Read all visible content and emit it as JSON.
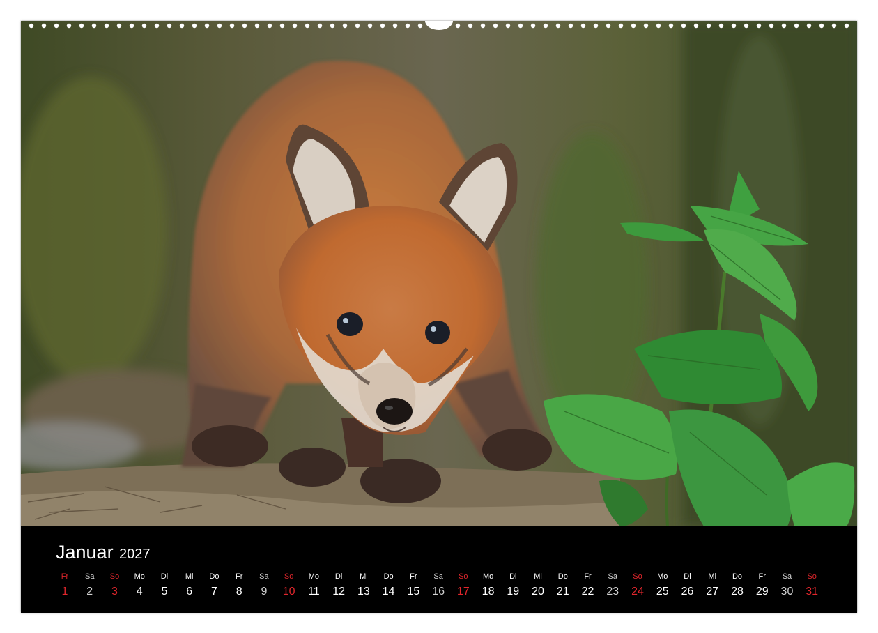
{
  "calendar": {
    "month": "Januar",
    "year": "2027",
    "days": [
      {
        "dow": "Fr",
        "num": "1",
        "type": "holiday"
      },
      {
        "dow": "Sa",
        "num": "2",
        "type": "saturday"
      },
      {
        "dow": "So",
        "num": "3",
        "type": "sunday"
      },
      {
        "dow": "Mo",
        "num": "4",
        "type": "weekday"
      },
      {
        "dow": "Di",
        "num": "5",
        "type": "weekday"
      },
      {
        "dow": "Mi",
        "num": "6",
        "type": "weekday"
      },
      {
        "dow": "Do",
        "num": "7",
        "type": "weekday"
      },
      {
        "dow": "Fr",
        "num": "8",
        "type": "weekday"
      },
      {
        "dow": "Sa",
        "num": "9",
        "type": "saturday"
      },
      {
        "dow": "So",
        "num": "10",
        "type": "sunday"
      },
      {
        "dow": "Mo",
        "num": "11",
        "type": "weekday"
      },
      {
        "dow": "Di",
        "num": "12",
        "type": "weekday"
      },
      {
        "dow": "Mi",
        "num": "13",
        "type": "weekday"
      },
      {
        "dow": "Do",
        "num": "14",
        "type": "weekday"
      },
      {
        "dow": "Fr",
        "num": "15",
        "type": "weekday"
      },
      {
        "dow": "Sa",
        "num": "16",
        "type": "saturday"
      },
      {
        "dow": "So",
        "num": "17",
        "type": "sunday"
      },
      {
        "dow": "Mo",
        "num": "18",
        "type": "weekday"
      },
      {
        "dow": "Di",
        "num": "19",
        "type": "weekday"
      },
      {
        "dow": "Mi",
        "num": "20",
        "type": "weekday"
      },
      {
        "dow": "Do",
        "num": "21",
        "type": "weekday"
      },
      {
        "dow": "Fr",
        "num": "22",
        "type": "weekday"
      },
      {
        "dow": "Sa",
        "num": "23",
        "type": "saturday"
      },
      {
        "dow": "So",
        "num": "24",
        "type": "sunday"
      },
      {
        "dow": "Mo",
        "num": "25",
        "type": "weekday"
      },
      {
        "dow": "Di",
        "num": "26",
        "type": "weekday"
      },
      {
        "dow": "Mi",
        "num": "27",
        "type": "weekday"
      },
      {
        "dow": "Do",
        "num": "28",
        "type": "weekday"
      },
      {
        "dow": "Fr",
        "num": "29",
        "type": "weekday"
      },
      {
        "dow": "Sa",
        "num": "30",
        "type": "saturday"
      },
      {
        "dow": "So",
        "num": "31",
        "type": "sunday"
      }
    ]
  },
  "colors": {
    "page_background": "#ffffff",
    "strip_background": "#000000",
    "text": "#ffffff",
    "saturday": "#d0d0d0",
    "sunday_holiday": "#e0262c"
  },
  "photo": {
    "subject_icon": "fox-cub-photo-icon"
  }
}
